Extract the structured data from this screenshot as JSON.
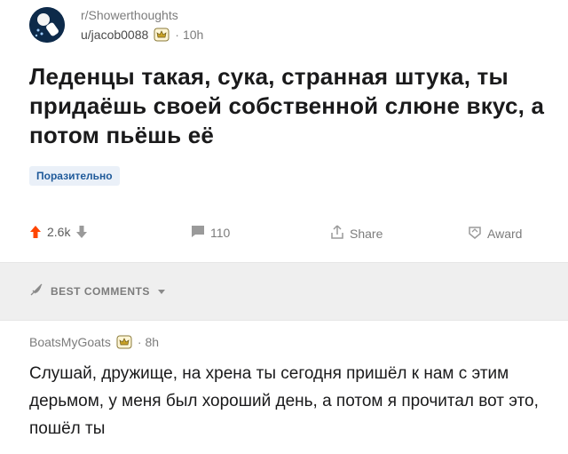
{
  "post": {
    "subreddit": "r/Showerthoughts",
    "author": "u/jacob0088",
    "age": "10h",
    "title": "Леденцы такая, сука, странная штука, ты придаёшь своей собственной слюне вкус, а потом пьёшь её",
    "flair": "Поразительно",
    "score": "2.6k",
    "comments_count": "110",
    "share_label": "Share",
    "award_label": "Award"
  },
  "comments_section": {
    "sort_label": "BEST COMMENTS"
  },
  "comment": {
    "author": "BoatsMyGoats",
    "age": "8h",
    "body": "Слушай, дружище, на хрена ты сегодня пришёл к нам с этим дерьмом, у меня был хороший день, а потом я прочитал вот это, пошёл ты"
  },
  "colors": {
    "upvote": "#ff4500",
    "flair_bg": "#eaf0f8",
    "flair_text": "#1f5a9a",
    "section_bg": "#efefef"
  },
  "icons": [
    "subreddit-avatar-icon",
    "award-badge-icon",
    "upvote-icon",
    "downvote-icon",
    "comment-icon",
    "share-icon",
    "award-icon",
    "sort-rocket-icon",
    "chevron-down-icon"
  ]
}
